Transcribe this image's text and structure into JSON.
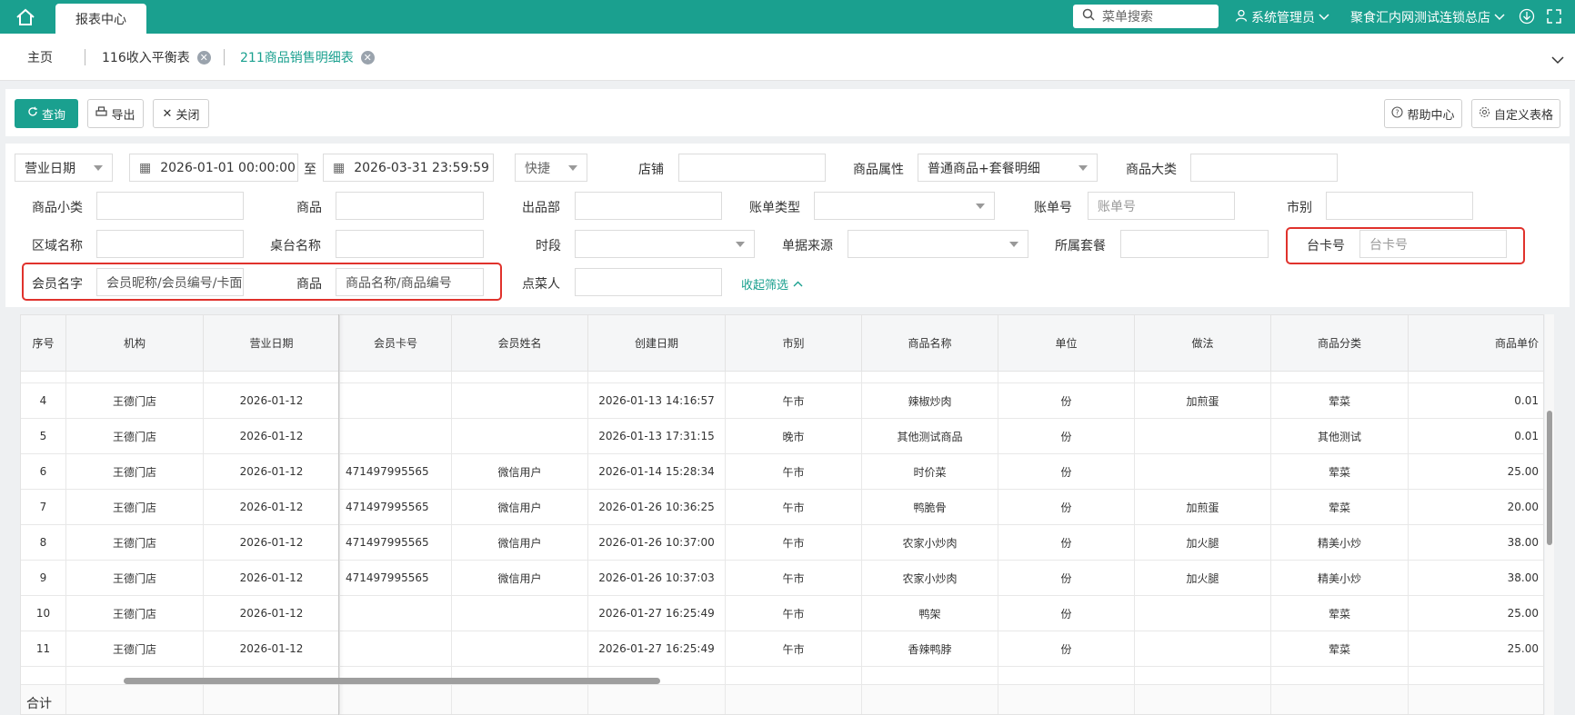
{
  "topbar": {
    "tab": "报表中心",
    "search_placeholder": "菜单搜索",
    "user": "系统管理员",
    "store": "聚食汇内网测试连锁总店"
  },
  "tabs": {
    "home": "主页",
    "tab1": "116收入平衡表",
    "tab2": "211商品销售明细表"
  },
  "toolbar": {
    "query": "查询",
    "export": "导出",
    "close": "关闭",
    "help": "帮助中心",
    "custom": "自定义表格"
  },
  "filters": {
    "date_type": "营业日期",
    "start": "2026-01-01 00:00:00",
    "to": "至",
    "end": "2026-03-31 23:59:59",
    "quick": "快捷",
    "shop": "店铺",
    "attr_label": "商品属性",
    "attr_value": "普通商品+套餐明细",
    "big_cat": "商品大类",
    "small_cat": "商品小类",
    "goods": "商品",
    "dept": "出品部",
    "bill_type": "账单类型",
    "bill_no": "账单号",
    "bill_no_ph": "账单号",
    "market": "市别",
    "area": "区域名称",
    "table_name": "桌台名称",
    "period": "时段",
    "source": "单据来源",
    "package": "所属套餐",
    "card_no": "台卡号",
    "card_no_ph": "台卡号",
    "member": "会员名字",
    "member_ph": "会员昵称/会员编号/卡面号",
    "goods2": "商品",
    "goods2_ph": "商品名称/商品编号",
    "orderer": "点菜人",
    "collapse": "收起筛选"
  },
  "table": {
    "headers": [
      "序号",
      "机构",
      "营业日期",
      "会员卡号",
      "会员姓名",
      "创建日期",
      "市别",
      "商品名称",
      "单位",
      "做法",
      "商品分类",
      "商品单价"
    ],
    "rows": [
      [
        "4",
        "王德门店",
        "2026-01-12",
        "",
        "",
        "2026-01-13 14:16:57",
        "午市",
        "辣椒炒肉",
        "份",
        "加煎蛋",
        "荤菜",
        "0.01"
      ],
      [
        "5",
        "王德门店",
        "2026-01-12",
        "",
        "",
        "2026-01-13 17:31:15",
        "晚市",
        "其他测试商品",
        "份",
        "",
        "其他测试",
        "0.01"
      ],
      [
        "6",
        "王德门店",
        "2026-01-12",
        "471497995565",
        "微信用户",
        "2026-01-14 15:28:34",
        "午市",
        "时价菜",
        "份",
        "",
        "荤菜",
        "25.00"
      ],
      [
        "7",
        "王德门店",
        "2026-01-12",
        "471497995565",
        "微信用户",
        "2026-01-26 10:36:25",
        "午市",
        "鸭脆骨",
        "份",
        "加煎蛋",
        "荤菜",
        "20.00"
      ],
      [
        "8",
        "王德门店",
        "2026-01-12",
        "471497995565",
        "微信用户",
        "2026-01-26 10:37:00",
        "午市",
        "农家小炒肉",
        "份",
        "加火腿",
        "精美小炒",
        "38.00"
      ],
      [
        "9",
        "王德门店",
        "2026-01-12",
        "471497995565",
        "微信用户",
        "2026-01-26 10:37:03",
        "午市",
        "农家小炒肉",
        "份",
        "加火腿",
        "精美小炒",
        "38.00"
      ],
      [
        "10",
        "王德门店",
        "2026-01-12",
        "",
        "",
        "2026-01-27 16:25:49",
        "午市",
        "鸭架",
        "份",
        "",
        "荤菜",
        "25.00"
      ],
      [
        "11",
        "王德门店",
        "2026-01-12",
        "",
        "",
        "2026-01-27 16:25:49",
        "午市",
        "香辣鸭脖",
        "份",
        "",
        "荤菜",
        "25.00"
      ]
    ],
    "total": "合计"
  }
}
